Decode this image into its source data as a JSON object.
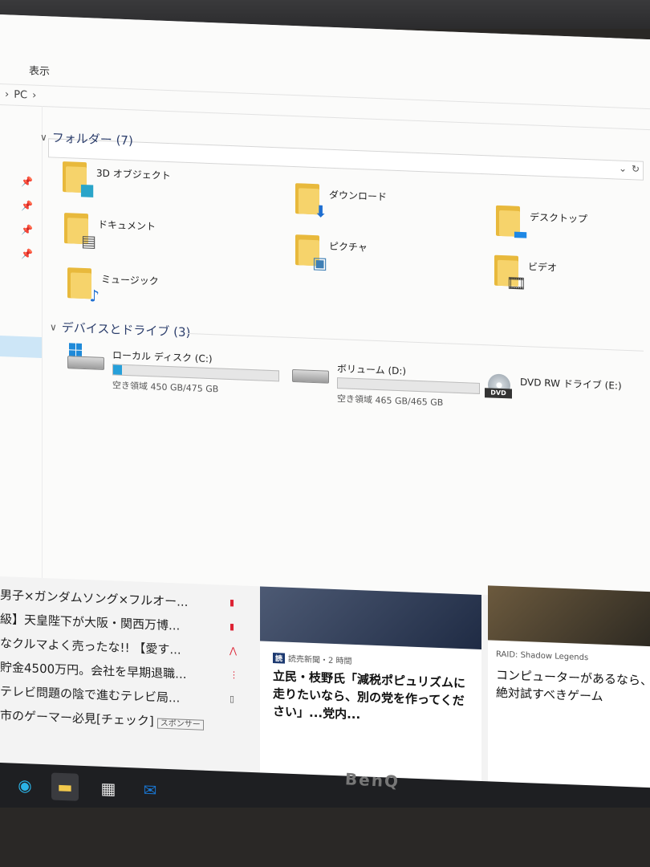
{
  "ribbon": {
    "tab_view": "表示"
  },
  "address": {
    "chevron": "›",
    "location": "PC",
    "trail": "›"
  },
  "sections": {
    "folders": {
      "title": "フォルダー (7)"
    },
    "devices": {
      "title": "デバイスとドライブ (3)"
    }
  },
  "folders": [
    {
      "label": "3D オブジェクト",
      "icon": "cube-3d-icon"
    },
    {
      "label": "ダウンロード",
      "icon": "download-arrow-icon"
    },
    {
      "label": "デスクトップ",
      "icon": "desktop-icon"
    },
    {
      "label": "ドキュメント",
      "icon": "document-icon"
    },
    {
      "label": "ピクチャ",
      "icon": "picture-icon"
    },
    {
      "label": "ビデオ",
      "icon": "film-icon"
    },
    {
      "label": "ミュージック",
      "icon": "music-note-icon"
    }
  ],
  "drives": [
    {
      "name": "ローカル ディスク (C:)",
      "free": "空き領域 450 GB/475 GB",
      "used_fraction": 0.053
    },
    {
      "name": "ボリューム (D:)",
      "free": "空き領域 465 GB/465 GB",
      "used_fraction": 0.0
    },
    {
      "name": "DVD RW ドライブ (E:)",
      "badge": "DVD"
    }
  ],
  "news": {
    "left": [
      "男子×ガンダムソング×フルオー...",
      "級】天皇陛下が大阪・関西万博...",
      "なクルマよく売ったな!! 【愛す...",
      "貯金4500万円。会社を早期退職...",
      "テレビ問題の陰で進むテレビ局...",
      "市のゲーマー必見[チェック]"
    ],
    "sponsor": "スポンサー",
    "card1": {
      "logo": "読",
      "source": "読売新聞・2 時間",
      "headline": "立民・枝野氏「減税ポピュリズムに走りたいなら、別の党を作ってください」...党内..."
    },
    "card2": {
      "source": "RAID: Shadow Legends",
      "headline": "コンピューターがあるなら、絶対試すべきゲーム"
    }
  },
  "monitor": {
    "brand": "BenQ"
  }
}
